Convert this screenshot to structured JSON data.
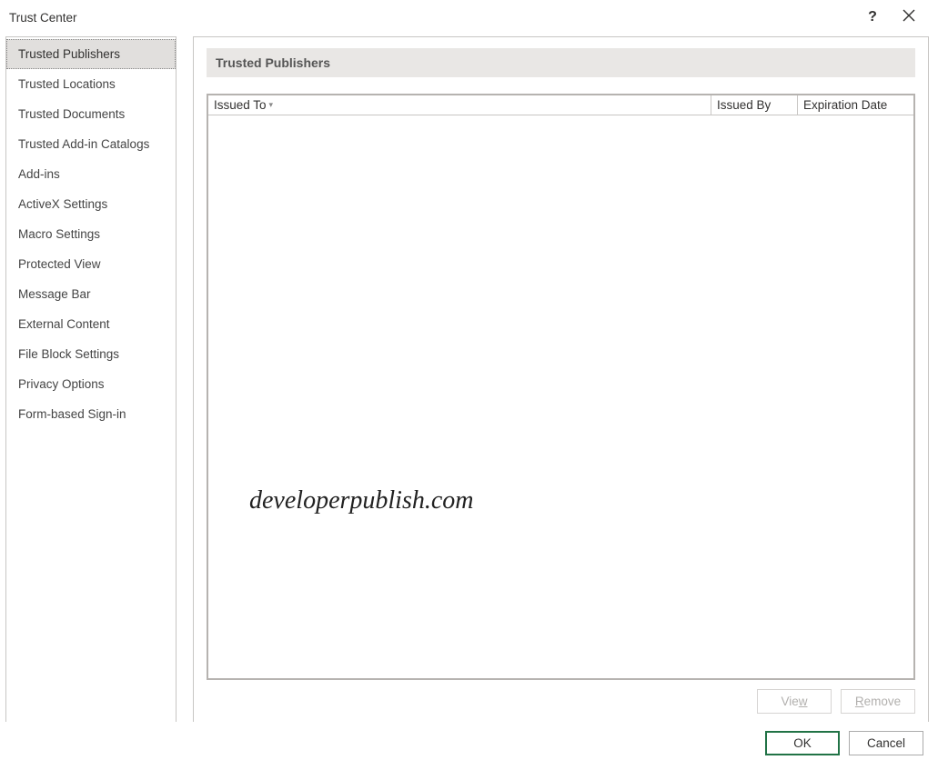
{
  "window": {
    "title": "Trust Center"
  },
  "sidebar": {
    "items": [
      {
        "label": "Trusted Publishers",
        "selected": true
      },
      {
        "label": "Trusted Locations",
        "selected": false
      },
      {
        "label": "Trusted Documents",
        "selected": false
      },
      {
        "label": "Trusted Add-in Catalogs",
        "selected": false
      },
      {
        "label": "Add-ins",
        "selected": false
      },
      {
        "label": "ActiveX Settings",
        "selected": false
      },
      {
        "label": "Macro Settings",
        "selected": false
      },
      {
        "label": "Protected View",
        "selected": false
      },
      {
        "label": "Message Bar",
        "selected": false
      },
      {
        "label": "External Content",
        "selected": false
      },
      {
        "label": "File Block Settings",
        "selected": false
      },
      {
        "label": "Privacy Options",
        "selected": false
      },
      {
        "label": "Form-based Sign-in",
        "selected": false
      }
    ]
  },
  "content": {
    "header": "Trusted Publishers",
    "columns": {
      "issued_to": "Issued To",
      "issued_by": "Issued By",
      "expiration": "Expiration Date"
    },
    "rows": [],
    "watermark": "developerpublish.com",
    "buttons": {
      "view": {
        "pre": "Vie",
        "mnemonic": "w",
        "post": ""
      },
      "remove": {
        "pre": "",
        "mnemonic": "R",
        "post": "emove"
      }
    }
  },
  "dialog_buttons": {
    "ok": "OK",
    "cancel": "Cancel"
  }
}
